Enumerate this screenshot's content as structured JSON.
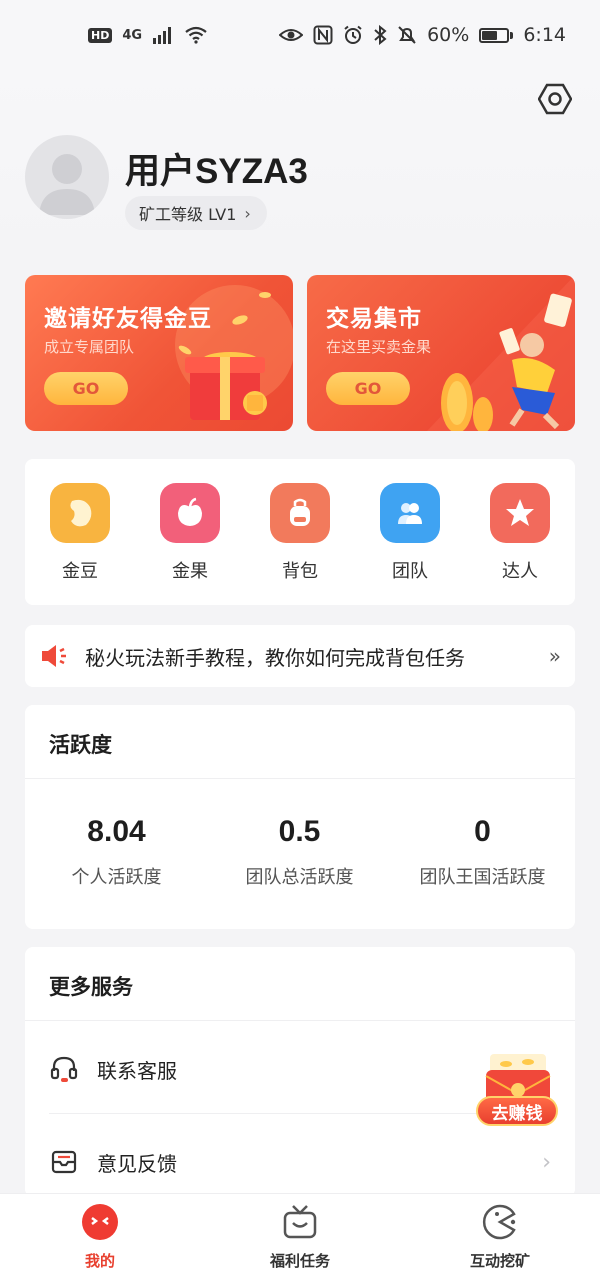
{
  "status_bar": {
    "network": "HD",
    "signal_type": "4G",
    "battery_percent": "60%",
    "battery_level": 0.6,
    "time": "6:14",
    "icons": [
      "hd-icon",
      "signal-icon",
      "wifi-icon",
      "eye-icon",
      "nfc-icon",
      "alarm-icon",
      "bluetooth-icon",
      "mute-icon",
      "battery-icon"
    ]
  },
  "profile": {
    "username": "用户SYZA3",
    "level_label": "矿工等级 LV1",
    "level_chevron": "›"
  },
  "banners": [
    {
      "title": "邀请好友得金豆",
      "subtitle": "成立专属团队",
      "button": "GO"
    },
    {
      "title": "交易集市",
      "subtitle": "在这里买卖金果",
      "button": "GO"
    }
  ],
  "menu": [
    {
      "label": "金豆",
      "icon": "bean-icon",
      "color": "#f8b440"
    },
    {
      "label": "金果",
      "icon": "apple-icon",
      "color": "#f2607a"
    },
    {
      "label": "背包",
      "icon": "backpack-icon",
      "color": "#f27a5c"
    },
    {
      "label": "团队",
      "icon": "team-icon",
      "color": "#3fa3f2"
    },
    {
      "label": "达人",
      "icon": "star-icon",
      "color": "#f26a5c"
    }
  ],
  "notice": {
    "text": "秘火玩法新手教程，教你如何完成背包任务",
    "arrow": "»"
  },
  "activity": {
    "title": "活跃度",
    "stats": [
      {
        "value": "8.04",
        "label": "个人活跃度"
      },
      {
        "value": "0.5",
        "label": "团队总活跃度"
      },
      {
        "value": "0",
        "label": "团队王国活跃度"
      }
    ]
  },
  "services": {
    "title": "更多服务",
    "items": [
      {
        "label": "联系客服",
        "icon": "headset-icon"
      },
      {
        "label": "意见反馈",
        "icon": "feedback-icon"
      }
    ],
    "arrow": "›",
    "earn_label": "去赚钱"
  },
  "tabbar": [
    {
      "label": "我的",
      "icon": "mine-icon",
      "active": true
    },
    {
      "label": "福利任务",
      "icon": "tv-icon",
      "active": false
    },
    {
      "label": "互动挖矿",
      "icon": "pacman-icon",
      "active": false
    }
  ]
}
